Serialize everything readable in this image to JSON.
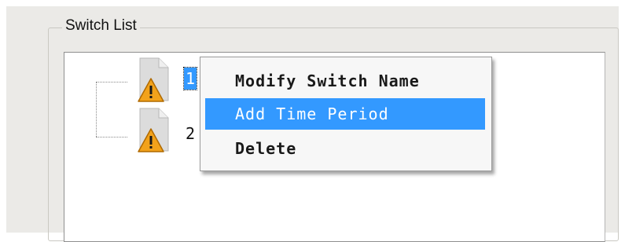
{
  "group": {
    "label": "Switch List"
  },
  "tree": {
    "nodes": [
      {
        "label": "1",
        "icon": "document-warning-icon",
        "selected": true
      },
      {
        "label": "2",
        "icon": "document-warning-icon",
        "selected": false
      }
    ]
  },
  "context_menu": {
    "items": [
      {
        "label": "Modify Switch Name"
      },
      {
        "label": "Add Time Period",
        "highlighted": true
      },
      {
        "label": "Delete"
      }
    ]
  },
  "colors": {
    "selection": "#3399ff",
    "window_bg": "#ebeae7",
    "warning": "#f2a21b"
  }
}
